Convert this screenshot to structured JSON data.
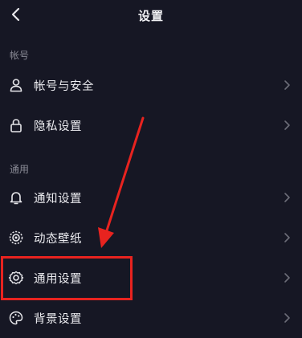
{
  "header": {
    "title": "设置",
    "back_icon": "chevron-left-icon"
  },
  "sections": [
    {
      "label": "帐号",
      "items": [
        {
          "label": "帐号与安全",
          "icon": "user-icon"
        },
        {
          "label": "隐私设置",
          "icon": "lock-icon"
        }
      ]
    },
    {
      "label": "通用",
      "items": [
        {
          "label": "通知设置",
          "icon": "bell-icon"
        },
        {
          "label": "动态壁纸",
          "icon": "wallpaper-icon"
        },
        {
          "label": "通用设置",
          "icon": "gear-icon"
        },
        {
          "label": "背景设置",
          "icon": "palette-icon"
        }
      ]
    }
  ],
  "annotation": {
    "highlight_color": "#e8231f",
    "highlighted_item": "通用设置"
  },
  "colors": {
    "background": "#161724",
    "text": "#ececf0",
    "section_label": "#8a8b96",
    "chevron": "#6c6d78"
  }
}
